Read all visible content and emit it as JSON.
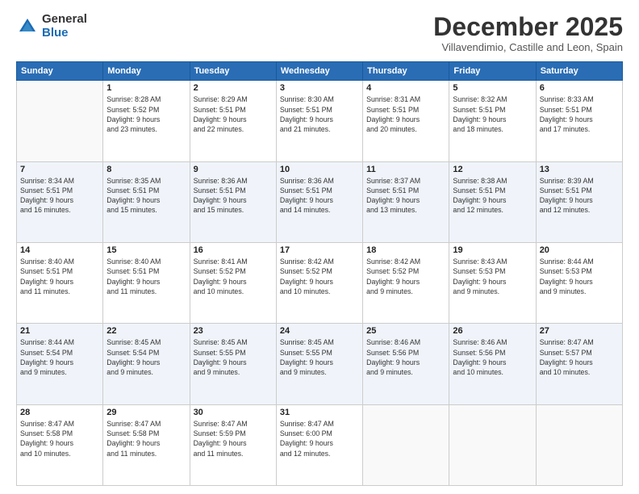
{
  "logo": {
    "general": "General",
    "blue": "Blue"
  },
  "header": {
    "month": "December 2025",
    "location": "Villavendimio, Castille and Leon, Spain"
  },
  "weekdays": [
    "Sunday",
    "Monday",
    "Tuesday",
    "Wednesday",
    "Thursday",
    "Friday",
    "Saturday"
  ],
  "weeks": [
    [
      {
        "day": "",
        "info": ""
      },
      {
        "day": "1",
        "info": "Sunrise: 8:28 AM\nSunset: 5:52 PM\nDaylight: 9 hours\nand 23 minutes."
      },
      {
        "day": "2",
        "info": "Sunrise: 8:29 AM\nSunset: 5:51 PM\nDaylight: 9 hours\nand 22 minutes."
      },
      {
        "day": "3",
        "info": "Sunrise: 8:30 AM\nSunset: 5:51 PM\nDaylight: 9 hours\nand 21 minutes."
      },
      {
        "day": "4",
        "info": "Sunrise: 8:31 AM\nSunset: 5:51 PM\nDaylight: 9 hours\nand 20 minutes."
      },
      {
        "day": "5",
        "info": "Sunrise: 8:32 AM\nSunset: 5:51 PM\nDaylight: 9 hours\nand 18 minutes."
      },
      {
        "day": "6",
        "info": "Sunrise: 8:33 AM\nSunset: 5:51 PM\nDaylight: 9 hours\nand 17 minutes."
      }
    ],
    [
      {
        "day": "7",
        "info": "Sunrise: 8:34 AM\nSunset: 5:51 PM\nDaylight: 9 hours\nand 16 minutes."
      },
      {
        "day": "8",
        "info": "Sunrise: 8:35 AM\nSunset: 5:51 PM\nDaylight: 9 hours\nand 15 minutes."
      },
      {
        "day": "9",
        "info": "Sunrise: 8:36 AM\nSunset: 5:51 PM\nDaylight: 9 hours\nand 15 minutes."
      },
      {
        "day": "10",
        "info": "Sunrise: 8:36 AM\nSunset: 5:51 PM\nDaylight: 9 hours\nand 14 minutes."
      },
      {
        "day": "11",
        "info": "Sunrise: 8:37 AM\nSunset: 5:51 PM\nDaylight: 9 hours\nand 13 minutes."
      },
      {
        "day": "12",
        "info": "Sunrise: 8:38 AM\nSunset: 5:51 PM\nDaylight: 9 hours\nand 12 minutes."
      },
      {
        "day": "13",
        "info": "Sunrise: 8:39 AM\nSunset: 5:51 PM\nDaylight: 9 hours\nand 12 minutes."
      }
    ],
    [
      {
        "day": "14",
        "info": "Sunrise: 8:40 AM\nSunset: 5:51 PM\nDaylight: 9 hours\nand 11 minutes."
      },
      {
        "day": "15",
        "info": "Sunrise: 8:40 AM\nSunset: 5:51 PM\nDaylight: 9 hours\nand 11 minutes."
      },
      {
        "day": "16",
        "info": "Sunrise: 8:41 AM\nSunset: 5:52 PM\nDaylight: 9 hours\nand 10 minutes."
      },
      {
        "day": "17",
        "info": "Sunrise: 8:42 AM\nSunset: 5:52 PM\nDaylight: 9 hours\nand 10 minutes."
      },
      {
        "day": "18",
        "info": "Sunrise: 8:42 AM\nSunset: 5:52 PM\nDaylight: 9 hours\nand 9 minutes."
      },
      {
        "day": "19",
        "info": "Sunrise: 8:43 AM\nSunset: 5:53 PM\nDaylight: 9 hours\nand 9 minutes."
      },
      {
        "day": "20",
        "info": "Sunrise: 8:44 AM\nSunset: 5:53 PM\nDaylight: 9 hours\nand 9 minutes."
      }
    ],
    [
      {
        "day": "21",
        "info": "Sunrise: 8:44 AM\nSunset: 5:54 PM\nDaylight: 9 hours\nand 9 minutes."
      },
      {
        "day": "22",
        "info": "Sunrise: 8:45 AM\nSunset: 5:54 PM\nDaylight: 9 hours\nand 9 minutes."
      },
      {
        "day": "23",
        "info": "Sunrise: 8:45 AM\nSunset: 5:55 PM\nDaylight: 9 hours\nand 9 minutes."
      },
      {
        "day": "24",
        "info": "Sunrise: 8:45 AM\nSunset: 5:55 PM\nDaylight: 9 hours\nand 9 minutes."
      },
      {
        "day": "25",
        "info": "Sunrise: 8:46 AM\nSunset: 5:56 PM\nDaylight: 9 hours\nand 9 minutes."
      },
      {
        "day": "26",
        "info": "Sunrise: 8:46 AM\nSunset: 5:56 PM\nDaylight: 9 hours\nand 10 minutes."
      },
      {
        "day": "27",
        "info": "Sunrise: 8:47 AM\nSunset: 5:57 PM\nDaylight: 9 hours\nand 10 minutes."
      }
    ],
    [
      {
        "day": "28",
        "info": "Sunrise: 8:47 AM\nSunset: 5:58 PM\nDaylight: 9 hours\nand 10 minutes."
      },
      {
        "day": "29",
        "info": "Sunrise: 8:47 AM\nSunset: 5:58 PM\nDaylight: 9 hours\nand 11 minutes."
      },
      {
        "day": "30",
        "info": "Sunrise: 8:47 AM\nSunset: 5:59 PM\nDaylight: 9 hours\nand 11 minutes."
      },
      {
        "day": "31",
        "info": "Sunrise: 8:47 AM\nSunset: 6:00 PM\nDaylight: 9 hours\nand 12 minutes."
      },
      {
        "day": "",
        "info": ""
      },
      {
        "day": "",
        "info": ""
      },
      {
        "day": "",
        "info": ""
      }
    ]
  ]
}
